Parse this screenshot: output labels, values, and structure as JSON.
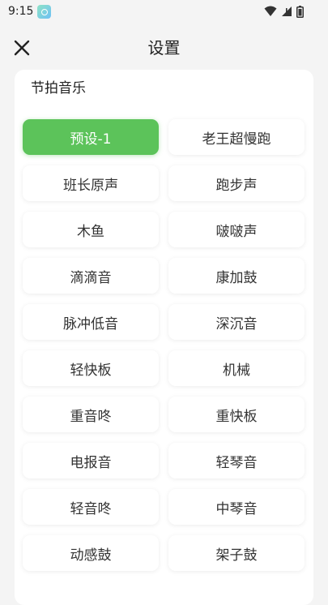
{
  "status_bar": {
    "time": "9:15",
    "icons": [
      "wifi-icon",
      "signal-icon",
      "battery-icon"
    ]
  },
  "header": {
    "title": "设置",
    "close_icon": "close-icon"
  },
  "section": {
    "title": "节拍音乐",
    "accent_color": "#5cc35a",
    "options": [
      {
        "label": "预设-1",
        "selected": true
      },
      {
        "label": "老王超慢跑",
        "selected": false
      },
      {
        "label": "班长原声",
        "selected": false
      },
      {
        "label": "跑步声",
        "selected": false
      },
      {
        "label": "木鱼",
        "selected": false
      },
      {
        "label": "啵啵声",
        "selected": false
      },
      {
        "label": "滴滴音",
        "selected": false
      },
      {
        "label": "康加鼓",
        "selected": false
      },
      {
        "label": "脉冲低音",
        "selected": false
      },
      {
        "label": "深沉音",
        "selected": false
      },
      {
        "label": "轻快板",
        "selected": false
      },
      {
        "label": "机械",
        "selected": false
      },
      {
        "label": "重音咚",
        "selected": false
      },
      {
        "label": "重快板",
        "selected": false
      },
      {
        "label": "电报音",
        "selected": false
      },
      {
        "label": "轻琴音",
        "selected": false
      },
      {
        "label": "轻音咚",
        "selected": false
      },
      {
        "label": "中琴音",
        "selected": false
      },
      {
        "label": "动感鼓",
        "selected": false
      },
      {
        "label": "架子鼓",
        "selected": false
      }
    ]
  }
}
